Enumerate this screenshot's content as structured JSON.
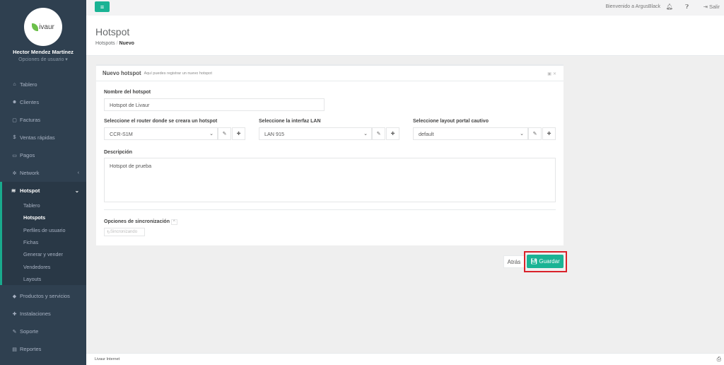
{
  "sidebar": {
    "logo_text": "ivaur",
    "user_name": "Hector Mendez Martínez",
    "user_options": "Opciones de usuario ▾",
    "items": [
      {
        "label": "Tablero",
        "icon": "dashboard-icon"
      },
      {
        "label": "Clientes",
        "icon": "users-icon"
      },
      {
        "label": "Facturas",
        "icon": "file-icon"
      },
      {
        "label": "Ventas rápidas",
        "icon": "dollar-icon"
      },
      {
        "label": "Pagos",
        "icon": "payment-icon"
      },
      {
        "label": "Network",
        "icon": "network-icon"
      }
    ],
    "active": {
      "label": "Hotspot",
      "icon": "wifi-icon",
      "sub_items": [
        "Tablero",
        "Hotspots",
        "Perfiles de usuario",
        "Fichas",
        "Generar y vender",
        "Vendedores",
        "Layouts"
      ]
    },
    "items_after": [
      {
        "label": "Productos y servicios",
        "icon": "tag-icon"
      },
      {
        "label": "Instalaciones",
        "icon": "tools-icon"
      },
      {
        "label": "Soporte",
        "icon": "wrench-icon"
      },
      {
        "label": "Reportes",
        "icon": "chart-icon"
      }
    ]
  },
  "topbar": {
    "welcome": "Bienvenido a ArgusBlack",
    "logout": "Salir"
  },
  "header": {
    "title": "Hotspot",
    "breadcrumb_parent": "Hotspots",
    "breadcrumb_current": "Nuevo"
  },
  "panel": {
    "title": "Nuevo hotspot",
    "subtitle": "Aquí puedes registrar un nuevo hotspot",
    "name_label": "Nombre del hotspot",
    "name_value": "Hotspot de Livaur",
    "router_label": "Seleccione el router donde se creara un hotspot",
    "router_value": "CCR-S1M",
    "lan_label": "Seleccione la interfaz LAN",
    "lan_value": "LAN 915",
    "layout_label": "Seleccione layout portal cautivo",
    "layout_value": "default",
    "desc_label": "Descripción",
    "desc_value": "Hotspot de prueba",
    "sync_label": "Opciones de sincronización",
    "sync_button": "Sincronizando"
  },
  "actions": {
    "back": "Atrás",
    "save": "Guardar"
  },
  "footer": {
    "text": "Livaur Internet"
  },
  "colors": {
    "sidebar": "#2f4050",
    "accent": "#1ab394",
    "highlight": "#d9222a"
  }
}
